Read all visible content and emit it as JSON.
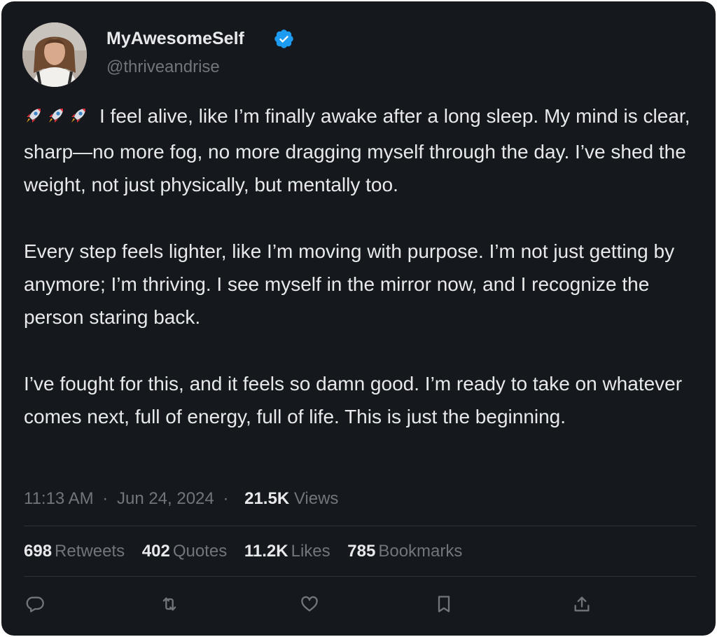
{
  "user": {
    "display_name": "MyAwesomeSelf",
    "handle": "@thriveandrise",
    "verified_color": "#1d9bf0"
  },
  "post": {
    "paragraphs": [
      "I feel alive, like I’m finally awake after a long sleep. My mind is clear, sharp—no more fog, no more dragging myself through the day. I’ve shed the weight, not just physically, but mentally too.",
      "Every step feels lighter, like I’m moving with purpose. I’m not just getting by anymore; I’m thriving. I see myself in the mirror now, and I recognize the person staring back.",
      "I’ve fought for this, and it feels so damn good. I’m ready to take on whatever comes next, full of energy, full of life. This is just the beginning."
    ],
    "leading_emoji": [
      "rocket-icon",
      "rocket-icon",
      "rocket-icon"
    ],
    "time": "11:13 AM",
    "date": "Jun 24, 2024",
    "separator": "·",
    "views_count": "21.5K",
    "views_label": "Views"
  },
  "stats": {
    "retweets": {
      "count": "698",
      "label": "Retweets"
    },
    "quotes": {
      "count": "402",
      "label": "Quotes"
    },
    "likes": {
      "count": "11.2K",
      "label": "Likes"
    },
    "bookmarks": {
      "count": "785",
      "label": "Bookmarks"
    }
  },
  "actions": [
    "reply-icon",
    "retweet-icon",
    "like-icon",
    "bookmark-icon",
    "share-icon"
  ],
  "colors": {
    "background": "#15181d",
    "text": "#e7e9ea",
    "muted": "#71767b",
    "divider": "#2f3336"
  }
}
